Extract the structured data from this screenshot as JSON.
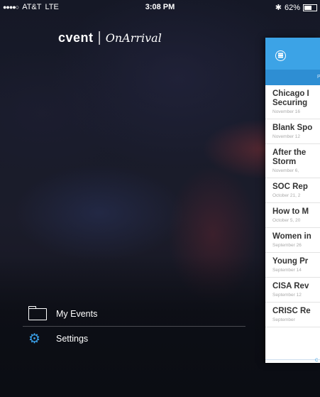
{
  "status_bar": {
    "signal": "●●●●○",
    "carrier": "AT&T",
    "network": "LTE",
    "time": "3:08 PM",
    "bluetooth": "✱",
    "battery": "62%",
    "battery_level": 0.62
  },
  "logo": {
    "brand": "cvent",
    "separator": "|",
    "product": "OnArrival"
  },
  "menu": {
    "items": [
      {
        "label": "My Events",
        "icon": "folder-icon"
      },
      {
        "label": "Settings",
        "icon": "gear-icon"
      }
    ]
  },
  "panel": {
    "header_color": "#3ca3e6",
    "tab_label": "P",
    "footer_label": "C",
    "events": [
      {
        "title_lines": [
          "Chicago I",
          "Securing"
        ],
        "date": "November 16"
      },
      {
        "title_lines": [
          "Blank Spo"
        ],
        "date": "November 12"
      },
      {
        "title_lines": [
          "After the",
          "Storm"
        ],
        "date": "November 6,"
      },
      {
        "title_lines": [
          "SOC Rep"
        ],
        "date": "October 21, 2"
      },
      {
        "title_lines": [
          "How to M"
        ],
        "date": "October 5, 20"
      },
      {
        "title_lines": [
          "Women in"
        ],
        "date": "September 26"
      },
      {
        "title_lines": [
          "Young Pr"
        ],
        "date": "September 14"
      },
      {
        "title_lines": [
          "CISA Rev"
        ],
        "date": "September 12"
      },
      {
        "title_lines": [
          "CRISC Re"
        ],
        "date": "September"
      }
    ]
  },
  "colors": {
    "accent": "#3ca3e6",
    "accent_dark": "#2e8ed3",
    "settings_icon": "#3aa0e8"
  }
}
